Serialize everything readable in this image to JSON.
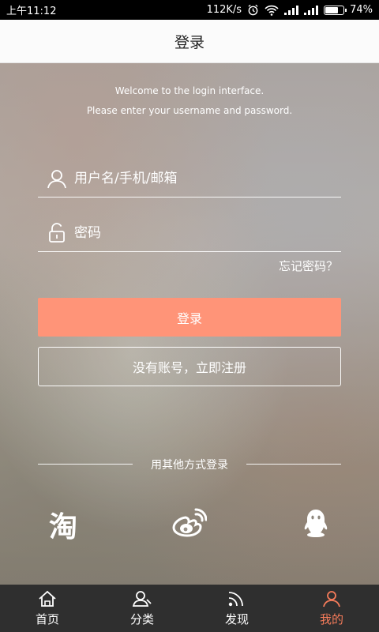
{
  "status_bar": {
    "time": "上午11:12",
    "net_speed": "112K/s",
    "battery": "74%",
    "battery_level": 0.74
  },
  "header": {
    "title": "登录"
  },
  "welcome": {
    "line1": "Welcome to the login interface.",
    "line2": "Please enter your username and password."
  },
  "form": {
    "username_placeholder": "用户名/手机/邮箱",
    "password_placeholder": "密码",
    "forgot_label": "忘记密码？",
    "login_label": "登录",
    "register_label": "没有账号，立即注册"
  },
  "other_login": {
    "label": "用其他方式登录",
    "providers": [
      {
        "name": "taobao",
        "icon": "taobao-icon",
        "glyph": "淘"
      },
      {
        "name": "weibo",
        "icon": "weibo-icon"
      },
      {
        "name": "qq",
        "icon": "qq-icon"
      }
    ]
  },
  "tabbar": {
    "items": [
      {
        "label": "首页",
        "icon": "home-icon"
      },
      {
        "label": "分类",
        "icon": "category-icon"
      },
      {
        "label": "发现",
        "icon": "discover-icon"
      },
      {
        "label": "我的",
        "icon": "profile-icon",
        "active": true
      }
    ]
  },
  "colors": {
    "accent": "#ff9478",
    "active_tab": "#f47b5a",
    "tabbar_bg": "#2f2f2f"
  }
}
